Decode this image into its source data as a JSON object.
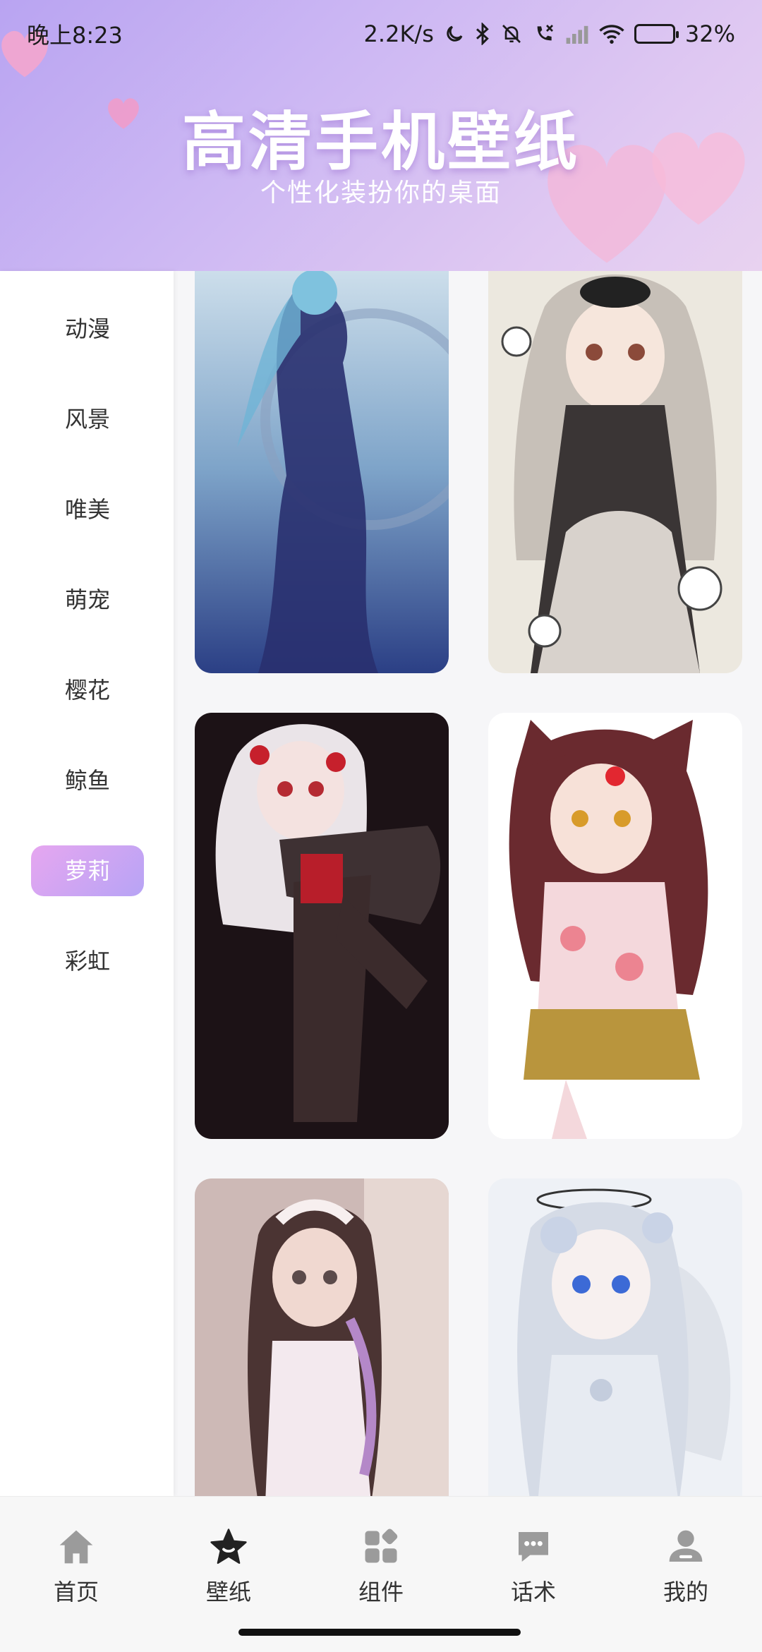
{
  "status_bar": {
    "time": "晚上8:23",
    "network_speed": "2.2K/s",
    "battery": "32%",
    "battery_level": 0.32,
    "icons": [
      "moon-icon",
      "bluetooth-icon",
      "mute-icon",
      "call-icon",
      "signal-icon",
      "wifi-icon",
      "battery-icon"
    ]
  },
  "header": {
    "title": "高清手机壁纸",
    "subtitle": "个性化装扮你的桌面"
  },
  "categories": [
    {
      "label": "动漫",
      "active": false
    },
    {
      "label": "风景",
      "active": false
    },
    {
      "label": "唯美",
      "active": false
    },
    {
      "label": "萌宠",
      "active": false
    },
    {
      "label": "樱花",
      "active": false
    },
    {
      "label": "鲸鱼",
      "active": false
    },
    {
      "label": "萝莉",
      "active": true
    },
    {
      "label": "彩虹",
      "active": false
    }
  ],
  "wallpapers": [
    {
      "name": "wallpaper-blue-dress",
      "palette": [
        "#cfe0ec",
        "#7ea4c9",
        "#2b3f85"
      ]
    },
    {
      "name": "wallpaper-maid-cat-girl",
      "palette": [
        "#f2efe8",
        "#cfc6bd",
        "#3a3535"
      ]
    },
    {
      "name": "wallpaper-white-hair-girl",
      "palette": [
        "#1c1216",
        "#3b2a2c",
        "#e8e2e5"
      ]
    },
    {
      "name": "wallpaper-cat-ear-girl",
      "palette": [
        "#ffffff",
        "#f4d8dc",
        "#6a2a2f"
      ]
    },
    {
      "name": "wallpaper-maid-brown-hair",
      "palette": [
        "#d9c7c3",
        "#b99e9f",
        "#f1e8ee"
      ]
    },
    {
      "name": "wallpaper-angel-girl",
      "palette": [
        "#eef1f6",
        "#d5dbe6",
        "#b8c2d6"
      ]
    }
  ],
  "bottom_nav": [
    {
      "label": "首页",
      "icon": "home-icon"
    },
    {
      "label": "壁纸",
      "icon": "star-icon"
    },
    {
      "label": "组件",
      "icon": "widgets-icon"
    },
    {
      "label": "话术",
      "icon": "chat-icon"
    },
    {
      "label": "我的",
      "icon": "profile-icon"
    }
  ],
  "colors": {
    "accent_gradient_start": "#e6a6f0",
    "accent_gradient_end": "#b7a4f5",
    "nav_icon": "#9b9b9b",
    "nav_icon_active": "#222222"
  }
}
